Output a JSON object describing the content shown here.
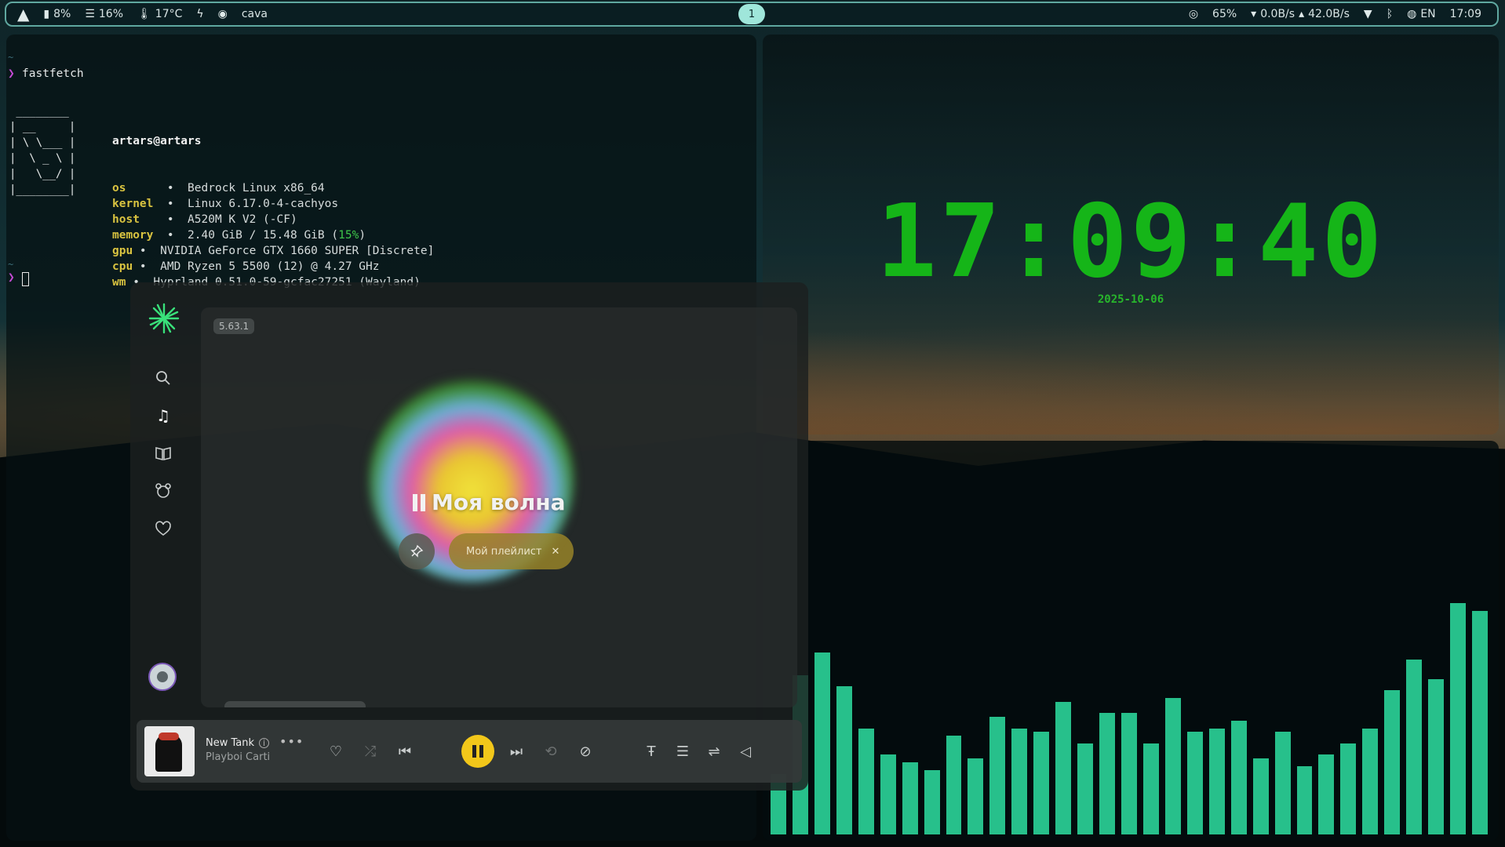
{
  "topbar": {
    "cpu": "8%",
    "mem": "16%",
    "temp": "17°C",
    "app": "cava",
    "workspace": "1",
    "brightness": "65%",
    "net_down": "0.0B/s",
    "net_up": "42.0B/s",
    "lang": "EN",
    "time": "17:09"
  },
  "terminal": {
    "command": "fastfetch",
    "ascii": [
      " ________ ",
      "| __     |",
      "| \\ \\___ |",
      "|  \\ _ \\ |",
      "|   \\__/ |",
      "|________|"
    ],
    "user": "artars@artars",
    "info": [
      {
        "key": "os",
        "sep": "      •  ",
        "value": "Bedrock Linux x86_64"
      },
      {
        "key": "kernel",
        "sep": "  •  ",
        "value": "Linux 6.17.0-4-cachyos"
      },
      {
        "key": "host",
        "sep": "    •  ",
        "value": "A520M K V2 (-CF)"
      },
      {
        "key": "memory",
        "sep": "  •  ",
        "value": "2.40 GiB / 15.48 GiB (",
        "pct": "15%",
        "tail": ")"
      },
      {
        "key": "gpu",
        "sep": " •  ",
        "value": "NVIDIA GeForce GTX 1660 SUPER [Discrete]"
      },
      {
        "key": "cpu",
        "sep": " •  ",
        "value": "AMD Ryzen 5 5500 (12) @ 4.27 GHz"
      },
      {
        "key": "wm",
        "sep": " •  ",
        "value": "Hyprland 0.51.0-59-gcfac27251 (Wayland)"
      }
    ]
  },
  "clock": {
    "time": "17:09:40",
    "date": "2025-10-06"
  },
  "music": {
    "version": "5.63.1",
    "wave_title": "Моя волна",
    "playlist_chip": "Мой плейлист",
    "track_title": "New Tank",
    "artist": "Playboi Carti"
  },
  "cava": {
    "levels": [
      0.16,
      0.42,
      0.48,
      0.39,
      0.28,
      0.21,
      0.19,
      0.17,
      0.26,
      0.2,
      0.31,
      0.28,
      0.27,
      0.35,
      0.24,
      0.32,
      0.32,
      0.24,
      0.36,
      0.27,
      0.28,
      0.3,
      0.2,
      0.27,
      0.18,
      0.21,
      0.24,
      0.28,
      0.38,
      0.46,
      0.41,
      0.61,
      0.59
    ]
  },
  "colors": {
    "accent_teal": "#5fa8a0",
    "clock_green": "#15b518",
    "cava_green": "#27c08b",
    "player_yellow": "#f2c71a",
    "prompt_magenta": "#c64bd6",
    "key_yellow": "#d9c340"
  }
}
